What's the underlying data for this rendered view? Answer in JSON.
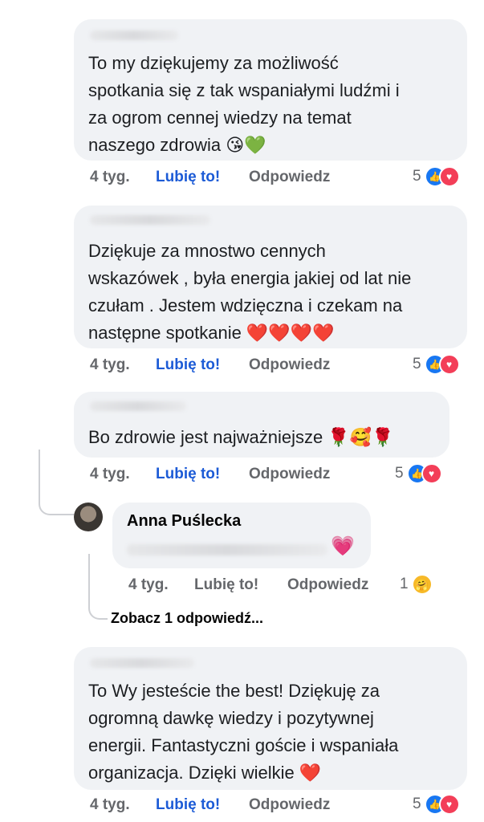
{
  "comments": [
    {
      "text": "To my dziękujemy za możliwość\nspotkania się z tak wspaniałymi ludźmi i\nza ogrom cennej wiedzy na temat\nnaszego zdrowia 😘💚",
      "time": "4 tyg.",
      "like": "Lubię to!",
      "reply": "Odpowiedz",
      "count": "5"
    },
    {
      "text": "Dziękuje za mnostwo cennych\nwskazówek , była energia jakiej od lat nie\nczułam . Jestem wdzięczna i czekam na\nnastępne spotkanie ❤️❤️❤️❤️",
      "time": "4 tyg.",
      "like": "Lubię to!",
      "reply": "Odpowiedz",
      "count": "5"
    },
    {
      "text": "Bo zdrowie jest najważniejsze 🌹🥰🌹",
      "time": "4 tyg.",
      "like": "Lubię to!",
      "reply": "Odpowiedz",
      "count": "5"
    },
    {
      "text": "To Wy jesteście the best! Dziękuję za\nogromną dawkę wiedzy i pozytywnej\nenergii. Fantastyczni goście i wspaniała\norganizacja. Dzięki wielkie ❤️",
      "time": "4 tyg.",
      "like": "Lubię to!",
      "reply": "Odpowiedz",
      "count": "5"
    }
  ],
  "reply": {
    "author": "Anna Puślecka",
    "text": "💗",
    "time": "4 tyg.",
    "like": "Lubię to!",
    "reply": "Odpowiedz",
    "count": "1"
  },
  "view_more": "Zobacz 1 odpowiedź...",
  "icons": {
    "like": "thumbs-up-icon",
    "love": "heart-icon",
    "care": "care-icon"
  },
  "colors": {
    "bubble": "#f0f2f5",
    "like_link": "#1c5bd6",
    "meta": "#65676b",
    "like_icon": "#1877f2",
    "love_icon": "#f33e58"
  }
}
